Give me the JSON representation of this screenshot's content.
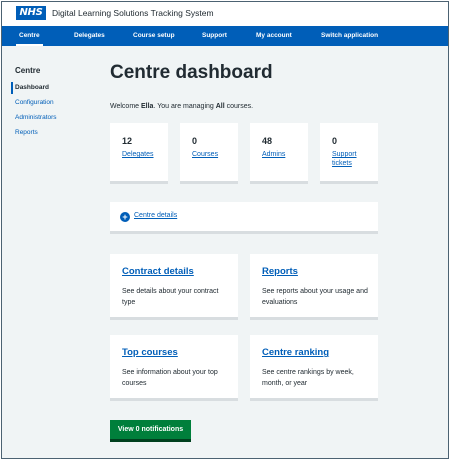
{
  "header": {
    "logo_text": "NHS",
    "app_title": "Digital Learning Solutions Tracking System"
  },
  "nav": {
    "items": [
      {
        "label": "Centre",
        "active": true
      },
      {
        "label": "Delegates",
        "active": false
      },
      {
        "label": "Course setup",
        "active": false
      },
      {
        "label": "Support",
        "active": false
      },
      {
        "label": "My account",
        "active": false
      },
      {
        "label": "Switch application",
        "active": false
      }
    ]
  },
  "sidebar": {
    "heading": "Centre",
    "items": [
      {
        "label": "Dashboard",
        "active": true
      },
      {
        "label": "Configuration",
        "active": false
      },
      {
        "label": "Administrators",
        "active": false
      },
      {
        "label": "Reports",
        "active": false
      }
    ]
  },
  "main": {
    "title": "Centre dashboard",
    "welcome_prefix": "Welcome ",
    "user_name": "Ella",
    "welcome_mid": ". You are managing ",
    "scope": "All",
    "welcome_suffix": " courses.",
    "stats": [
      {
        "value": "12",
        "label": "Delegates"
      },
      {
        "value": "0",
        "label": "Courses"
      },
      {
        "value": "48",
        "label": "Admins"
      },
      {
        "value": "0",
        "label": "Support tickets"
      }
    ],
    "centre_details_label": "Centre details",
    "promos": [
      {
        "title": "Contract details",
        "description": "See details about your contract type"
      },
      {
        "title": "Reports",
        "description": "See reports about your usage and evaluations"
      },
      {
        "title": "Top courses",
        "description": "See information about your top courses"
      },
      {
        "title": "Centre ranking",
        "description": "See centre rankings by week, month, or year"
      }
    ],
    "notifications_button": "View 0 notifications"
  },
  "colors": {
    "nhs_blue": "#005eb8",
    "background": "#f0f4f5",
    "button_green": "#007f3b",
    "text": "#212b32"
  }
}
